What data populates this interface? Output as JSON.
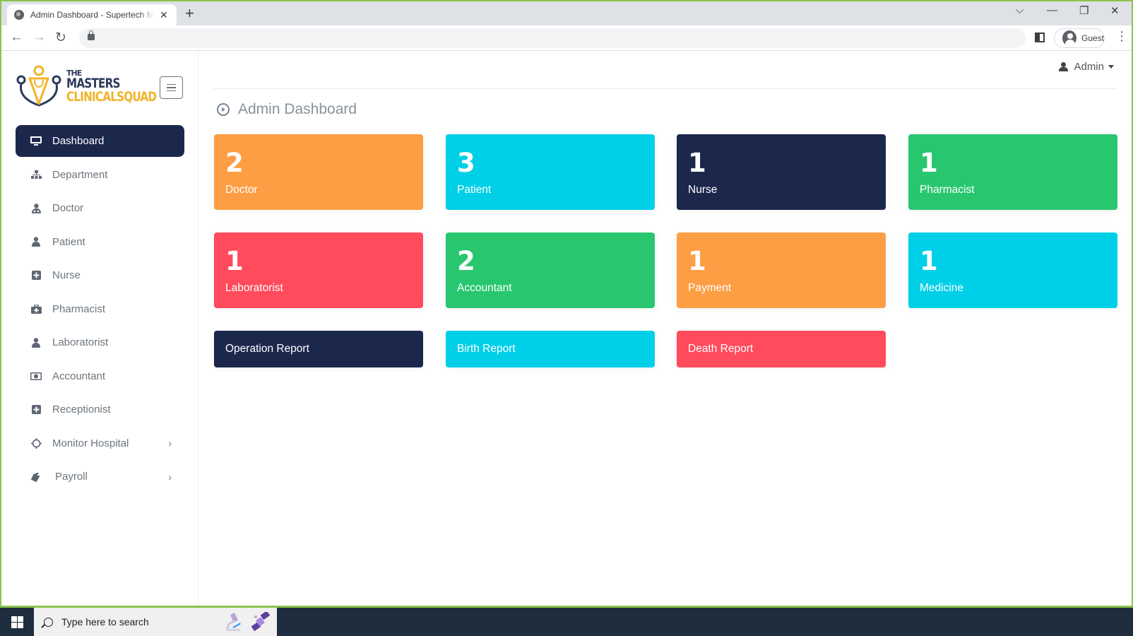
{
  "browser": {
    "tab_title": "Admin Dashboard - Supertech M",
    "new_tab": "+",
    "profile_label": "Guest",
    "controls": {
      "collapse": "⌵",
      "minimize": "—",
      "restore": "❐",
      "close": "✕"
    }
  },
  "sidebar": {
    "logo": {
      "line1": "THE",
      "line2": "MASTERS",
      "line3": "CLINICALSQUAD"
    },
    "items": [
      {
        "label": "Dashboard",
        "icon": "monitor-icon",
        "active": true
      },
      {
        "label": "Department",
        "icon": "sitemap-icon"
      },
      {
        "label": "Doctor",
        "icon": "user-doctor-icon"
      },
      {
        "label": "Patient",
        "icon": "user-icon"
      },
      {
        "label": "Nurse",
        "icon": "plus-square-icon"
      },
      {
        "label": "Pharmacist",
        "icon": "medkit-icon"
      },
      {
        "label": "Laboratorist",
        "icon": "user-icon"
      },
      {
        "label": "Accountant",
        "icon": "money-icon"
      },
      {
        "label": "Receptionist",
        "icon": "plus-square-icon"
      },
      {
        "label": "Monitor Hospital",
        "icon": "gear-icon",
        "has_submenu": true
      },
      {
        "label": "Payroll",
        "icon": "tag-icon",
        "has_submenu": true
      }
    ],
    "chevron": "›"
  },
  "header": {
    "user_label": "Admin"
  },
  "main": {
    "title": "Admin Dashboard",
    "stats": [
      {
        "value": "2",
        "label": "Doctor",
        "color": "#fd9e44"
      },
      {
        "value": "3",
        "label": "Patient",
        "color": "#00cfe8"
      },
      {
        "value": "1",
        "label": "Nurse",
        "color": "#1c274c"
      },
      {
        "value": "1",
        "label": "Pharmacist",
        "color": "#28c76f"
      },
      {
        "value": "1",
        "label": "Laboratorist",
        "color": "#ff4b5c"
      },
      {
        "value": "2",
        "label": "Accountant",
        "color": "#28c76f"
      },
      {
        "value": "1",
        "label": "Payment",
        "color": "#fd9e44"
      },
      {
        "value": "1",
        "label": "Medicine",
        "color": "#00cfe8"
      }
    ],
    "reports": [
      {
        "label": "Operation Report",
        "color": "#1c274c"
      },
      {
        "label": "Birth Report",
        "color": "#00cfe8"
      },
      {
        "label": "Death Report",
        "color": "#ff4b5c"
      }
    ]
  },
  "taskbar": {
    "search_placeholder": "Type here to search"
  }
}
